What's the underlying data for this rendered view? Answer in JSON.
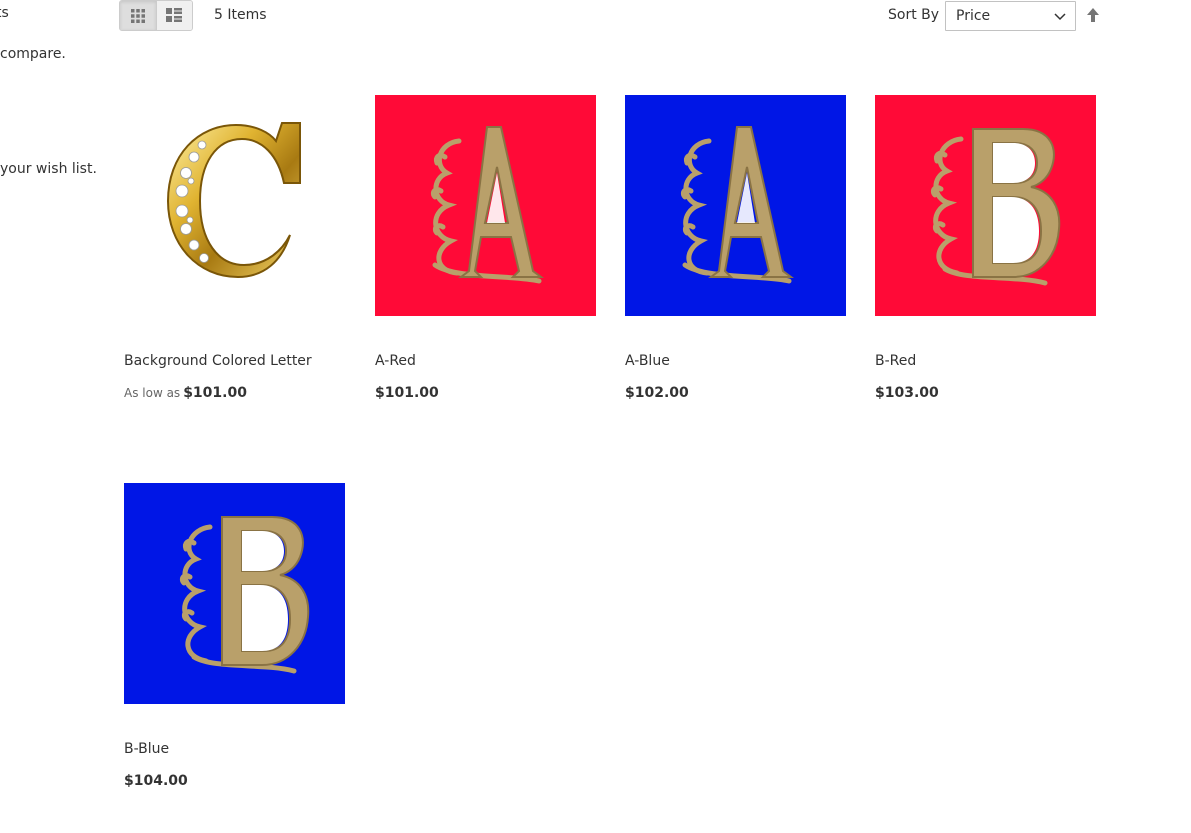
{
  "sidebar": {
    "heading_fragment": "ts",
    "compare_text": "compare.",
    "wishlist_text": "your wish list."
  },
  "toolbar": {
    "modes": [
      "grid-icon",
      "list-icon"
    ],
    "active_mode": "grid",
    "amount": "5 Items",
    "sort_label": "Sort By",
    "sort_selected": "Price",
    "sort_direction_icon": "arrow-up-icon"
  },
  "products": [
    {
      "name": "Background Colored Letter",
      "price_label": "As low as",
      "price": "$101.00",
      "image": {
        "letter": "C",
        "background": "#ffffff",
        "style": "gold-jeweled"
      }
    },
    {
      "name": "A-Red",
      "price_label": "",
      "price": "$101.00",
      "image": {
        "letter": "A",
        "background": "#ff0a37",
        "style": "gold-ornate"
      }
    },
    {
      "name": "A-Blue",
      "price_label": "",
      "price": "$102.00",
      "image": {
        "letter": "A",
        "background": "#0016e6",
        "style": "gold-ornate"
      }
    },
    {
      "name": "B-Red",
      "price_label": "",
      "price": "$103.00",
      "image": {
        "letter": "B",
        "background": "#ff0a37",
        "style": "gold-ornate"
      }
    },
    {
      "name": "B-Blue",
      "price_label": "",
      "price": "$104.00",
      "image": {
        "letter": "B",
        "background": "#0016e6",
        "style": "gold-ornate"
      }
    }
  ],
  "colors": {
    "gold": "#b9a06a",
    "gold_dark": "#8a7344",
    "red": "#ff0a37",
    "blue": "#0016e6"
  }
}
